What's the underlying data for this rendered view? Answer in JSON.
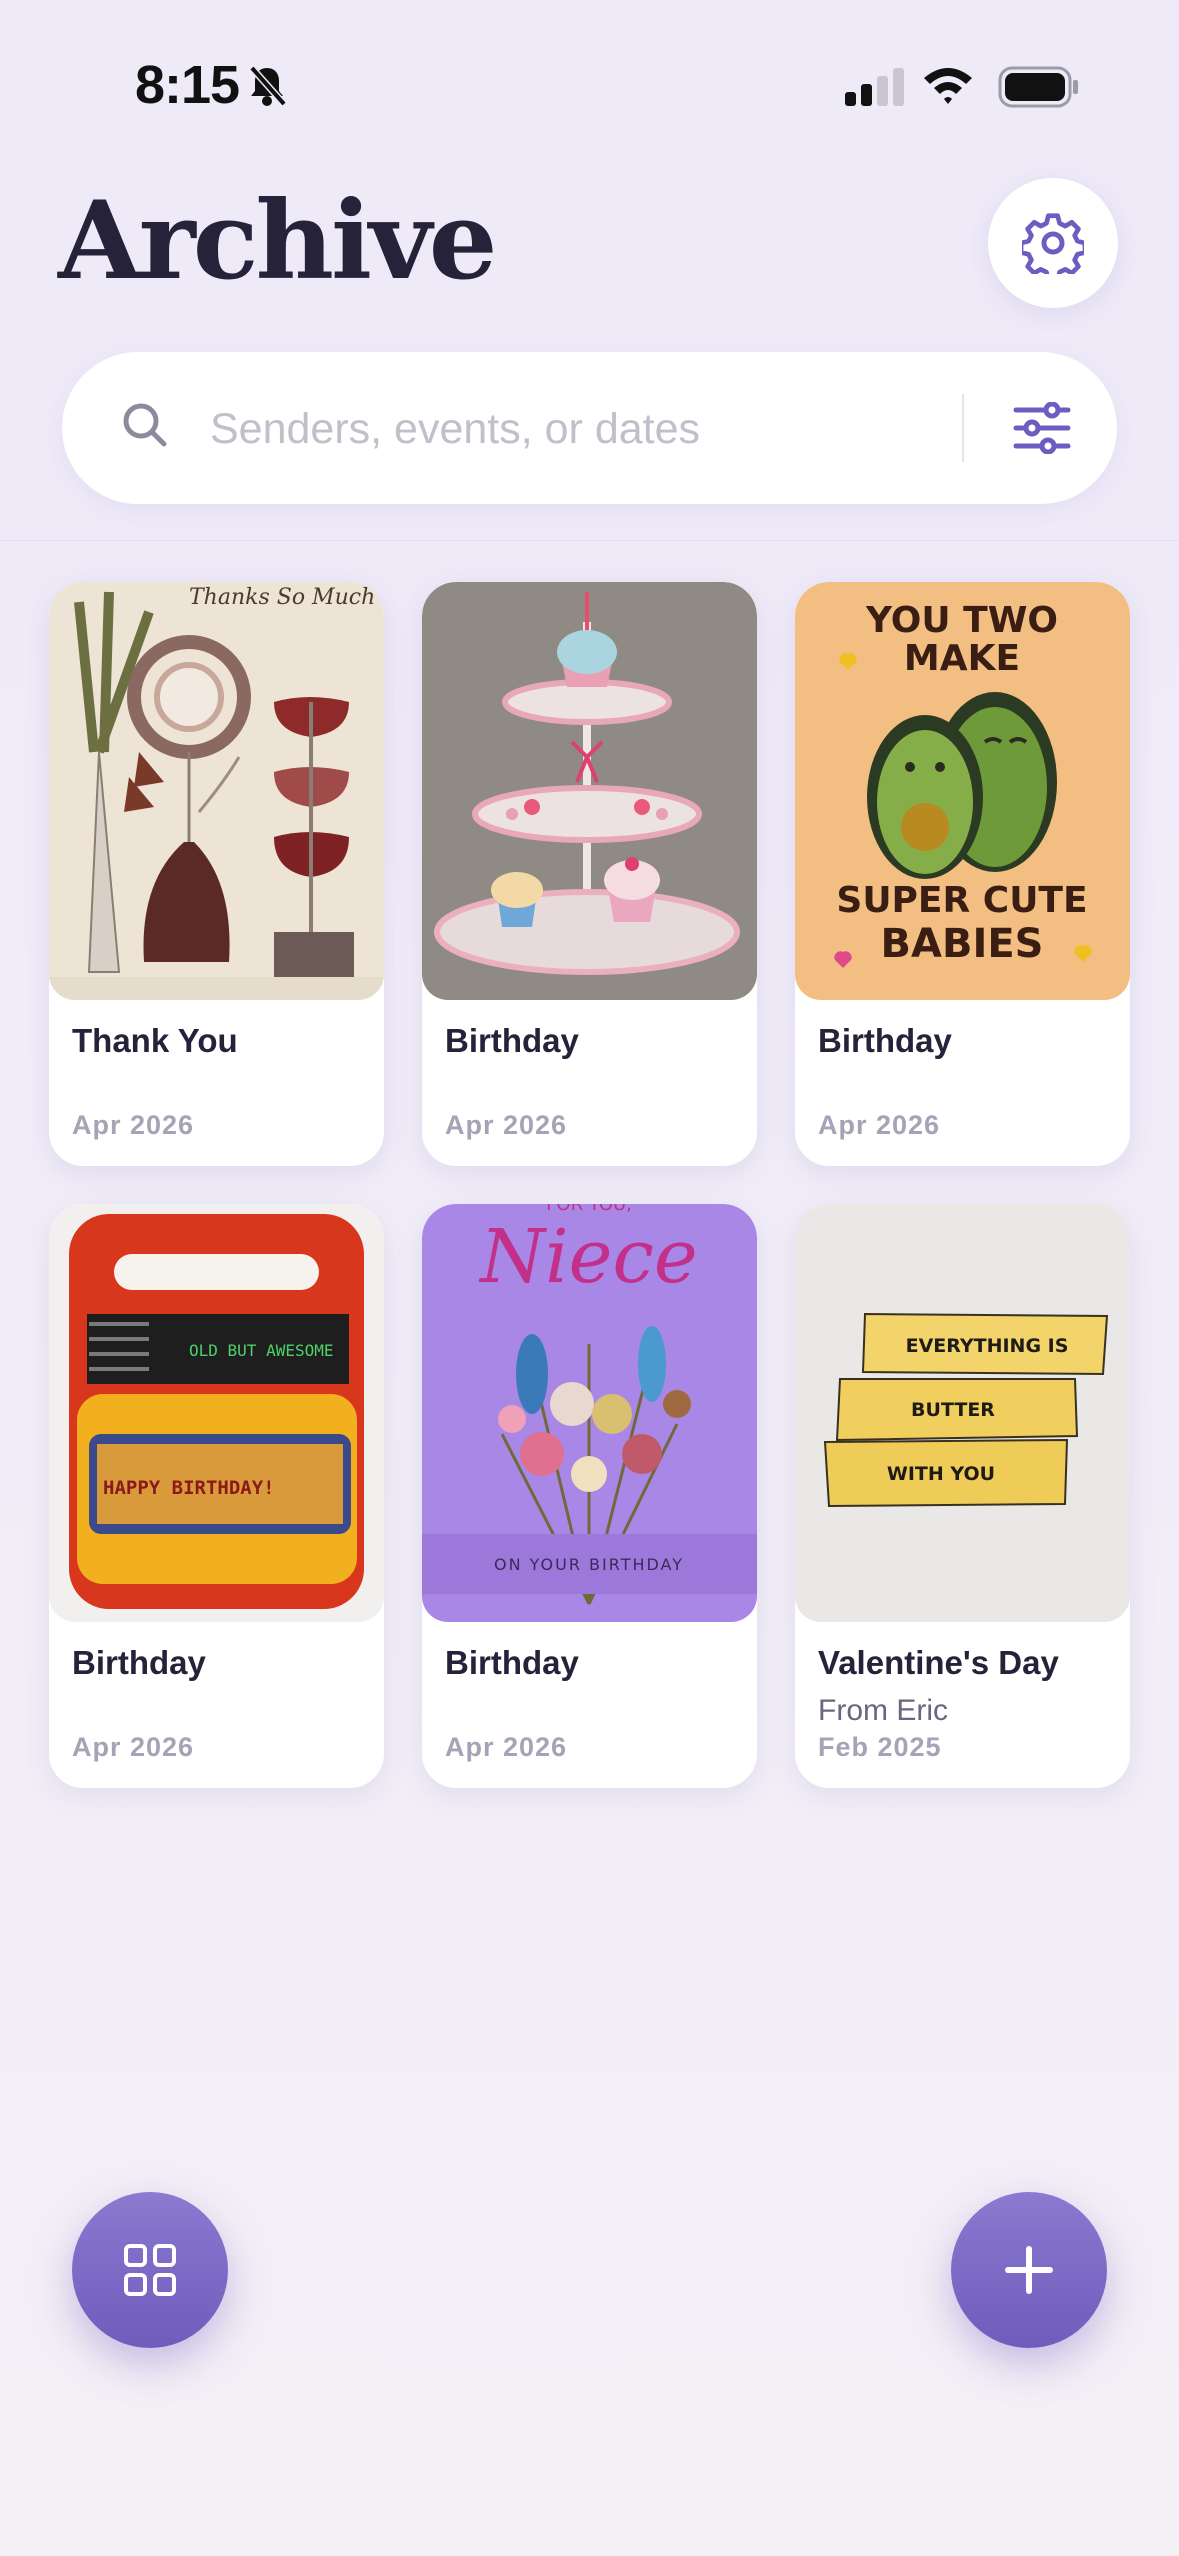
{
  "status_bar": {
    "time": "8:15",
    "icons": [
      "bell-slash-icon",
      "cellular-signal-icon",
      "wifi-icon",
      "battery-icon"
    ]
  },
  "header": {
    "title": "Archive",
    "settings_icon": "gear-icon"
  },
  "search": {
    "placeholder": "Senders, events, or dates",
    "value": "",
    "icon": "search-icon",
    "filter_icon": "sliders-icon"
  },
  "cards": [
    {
      "title": "Thank You",
      "sender": "",
      "date": "Apr 2026",
      "art_text": "Thanks So Much"
    },
    {
      "title": "Birthday",
      "sender": "",
      "date": "Apr 2026",
      "art_text": ""
    },
    {
      "title": "Birthday",
      "sender": "",
      "date": "Apr 2026",
      "art_text": "YOU TWO MAKE SUPER CUTE BABIES"
    },
    {
      "title": "Birthday",
      "sender": "",
      "date": "Apr 2026",
      "art_text": "OLD BUT AWESOME"
    },
    {
      "title": "Birthday",
      "sender": "",
      "date": "Apr 2026",
      "art_text": "FOR YOU, Niece ON YOUR BIRTHDAY"
    },
    {
      "title": "Valentine's Day",
      "sender": "From Eric",
      "date": "Feb 2025",
      "art_text": "EVERYTHING IS BUTTER WITH YOU"
    }
  ],
  "art": {
    "card3_top1": "YOU TWO",
    "card3_top2": "MAKE",
    "card3_bottom1": "SUPER CUTE",
    "card3_bottom2": "BABIES",
    "card1_script": "Thanks So Much",
    "card4_screen": "OLD BUT AWESOME",
    "card4_keys": "HAPPY BIRTHDAY!",
    "card5_top": "FOR YOU,",
    "card5_script": "Niece",
    "card5_band": "ON YOUR BIRTHDAY",
    "card6_line1": "EVERYTHING IS",
    "card6_line2": "BUTTER",
    "card6_line3": "WITH YOU"
  },
  "fabs": {
    "left_icon": "grid-icon",
    "right_icon": "plus-icon"
  },
  "colors": {
    "accent": "#7A68C6",
    "title": "#25223A",
    "muted": "#A7A2B6"
  }
}
